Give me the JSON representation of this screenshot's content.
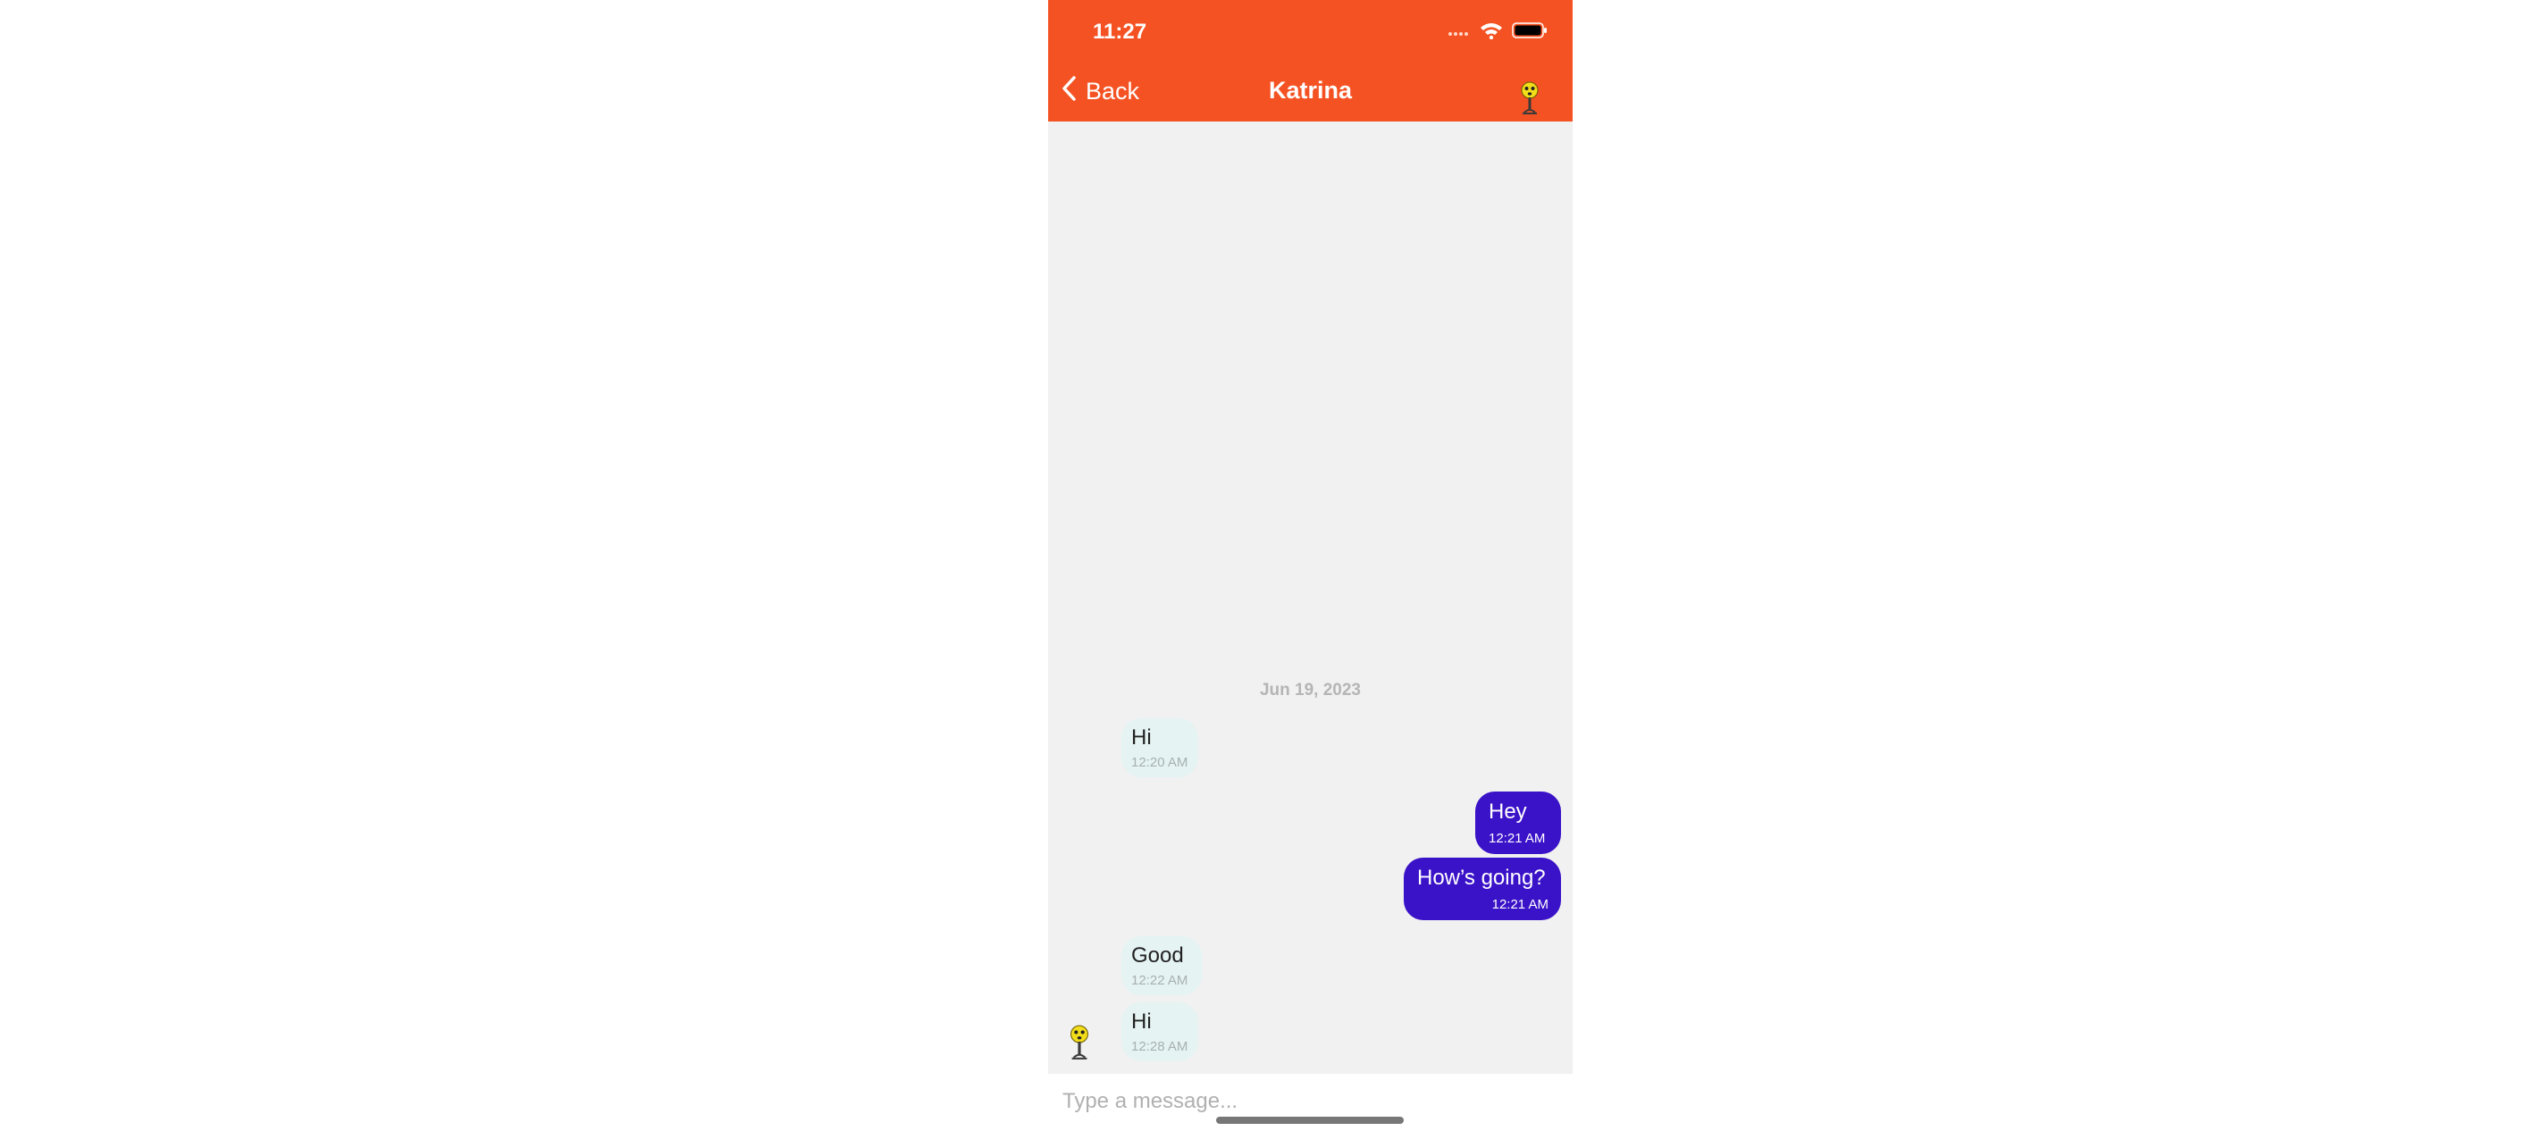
{
  "status_bar": {
    "time": "11:27"
  },
  "nav": {
    "back_label": "Back",
    "title": "Katrina",
    "back_icon": "chevron-left-icon",
    "avatar_icon": "emoji-avatar-icon"
  },
  "chat": {
    "date": "Jun 19, 2023",
    "messages": [
      {
        "direction": "in",
        "text": "Hi",
        "time": "12:20 AM"
      },
      {
        "direction": "out",
        "text": "Hey",
        "time": "12:21 AM"
      },
      {
        "direction": "out",
        "text": "How’s going?",
        "time": "12:21 AM"
      },
      {
        "direction": "in",
        "text": "Good",
        "time": "12:22 AM"
      },
      {
        "direction": "in",
        "text": "Hi",
        "time": "12:28 AM"
      }
    ]
  },
  "composer": {
    "placeholder": "Type a message..."
  },
  "colors": {
    "header": "#f55223",
    "outgoing_bubble": "#3a12c8",
    "incoming_bubble": "#e5f3f3",
    "chat_background": "#f1f1f1"
  }
}
